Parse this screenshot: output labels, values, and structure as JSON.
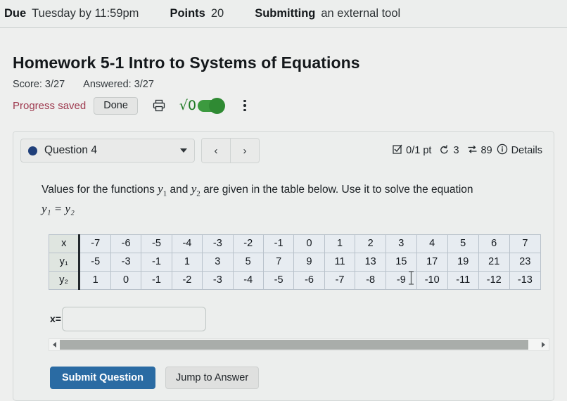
{
  "assignment_bar": {
    "due_label": "Due",
    "due_value": "Tuesday by 11:59pm",
    "points_label": "Points",
    "points_value": "20",
    "submitting_label": "Submitting",
    "submitting_value": "an external tool"
  },
  "header": {
    "title": "Homework 5-1 Intro to Systems of Equations",
    "score": "Score: 3/27",
    "answered": "Answered: 3/27",
    "progress_saved": "Progress saved",
    "done_label": "Done",
    "print_icon": "printer-icon",
    "sqrt_label": "√0",
    "sqrt_toggle_state": "on",
    "kebab_icon": "vertical-dots-icon",
    "progress_color": "#9e3a4f",
    "toggle_color": "#3c9a3f"
  },
  "question_bar": {
    "question_label": "Question 4",
    "status_dot_color": "#1f3f7a",
    "prev_icon": "‹",
    "next_icon": "›",
    "points": "0/1 pt",
    "attempts": "3",
    "views": "89",
    "details_label": "Details",
    "checkbox_icon": "checkbox-icon",
    "retry_icon": "retry-arrow-icon",
    "swap_icon": "swap-arrows-icon",
    "info_icon": "info-circle-icon"
  },
  "question": {
    "prompt_part1": "Values for the functions",
    "y1": "y",
    "y1_sub": "1",
    "prompt_and": "and",
    "y2": "y",
    "y2_sub": "2",
    "prompt_part2": "are given in the table below. Use it to solve the",
    "prompt_part3": "equation",
    "equation": "y₁ = y₂"
  },
  "table": {
    "row_labels": [
      "x",
      "y₁",
      "y₂"
    ],
    "x_values": [
      "-7",
      "-6",
      "-5",
      "-4",
      "-3",
      "-2",
      "-1",
      "0",
      "1",
      "2",
      "3",
      "4",
      "5",
      "6",
      "7"
    ],
    "y1_values": [
      "-5",
      "-3",
      "-1",
      "1",
      "3",
      "5",
      "7",
      "9",
      "11",
      "13",
      "15",
      "17",
      "19",
      "21",
      "23"
    ],
    "y2_values": [
      "1",
      "0",
      "-1",
      "-2",
      "-3",
      "-4",
      "-5",
      "-6",
      "-7",
      "-8",
      "-9",
      "-10",
      "-11",
      "-12",
      "-13"
    ]
  },
  "answer": {
    "label": "x=",
    "value": "",
    "placeholder": ""
  },
  "scrollbar": {
    "left_arrow": "scroll-left-arrow",
    "right_arrow": "scroll-right-arrow"
  },
  "footer": {
    "submit_label": "Submit Question",
    "jump_label": "Jump to Answer",
    "submit_color": "#2a6ba3"
  }
}
